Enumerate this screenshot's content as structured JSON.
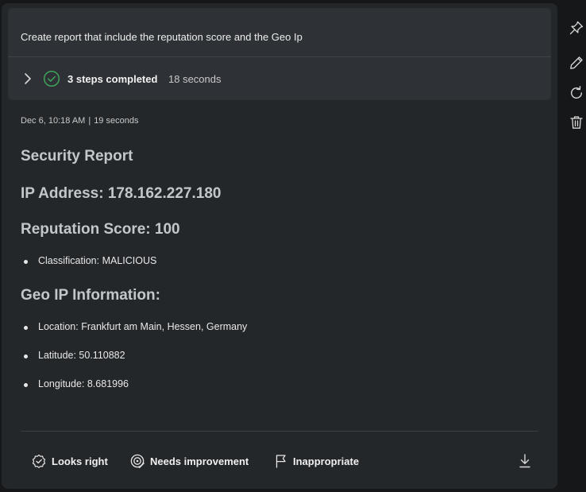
{
  "prompt": {
    "text": "Create report that include the reputation score and the Geo Ip"
  },
  "steps": {
    "label": "3 steps completed",
    "duration": "18 seconds",
    "status_color": "#3fa35a"
  },
  "meta": {
    "timestamp": "Dec 6, 10:18 AM",
    "separator": "|",
    "duration": "19 seconds"
  },
  "report": {
    "title": "Security Report",
    "ip_heading": "IP Address: 178.162.227.180",
    "reputation_heading": "Reputation Score: 100",
    "classification": "Classification: MALICIOUS",
    "geo_heading": "Geo IP Information:",
    "location": "Location: Frankfurt am Main, Hessen, Germany",
    "latitude": "Latitude: 50.110882",
    "longitude": "Longitude: 8.681996"
  },
  "feedback": {
    "looks_right": "Looks right",
    "needs_improvement": "Needs improvement",
    "inappropriate": "Inappropriate"
  },
  "icons": {
    "chevron": "chevron-right-icon",
    "check": "check-circle-icon",
    "looks_right": "badge-check-icon",
    "needs_improvement": "target-edit-icon",
    "inappropriate": "flag-icon",
    "download": "download-icon",
    "pin": "pin-icon",
    "edit": "pencil-icon",
    "refresh": "refresh-icon",
    "delete": "trash-icon"
  }
}
